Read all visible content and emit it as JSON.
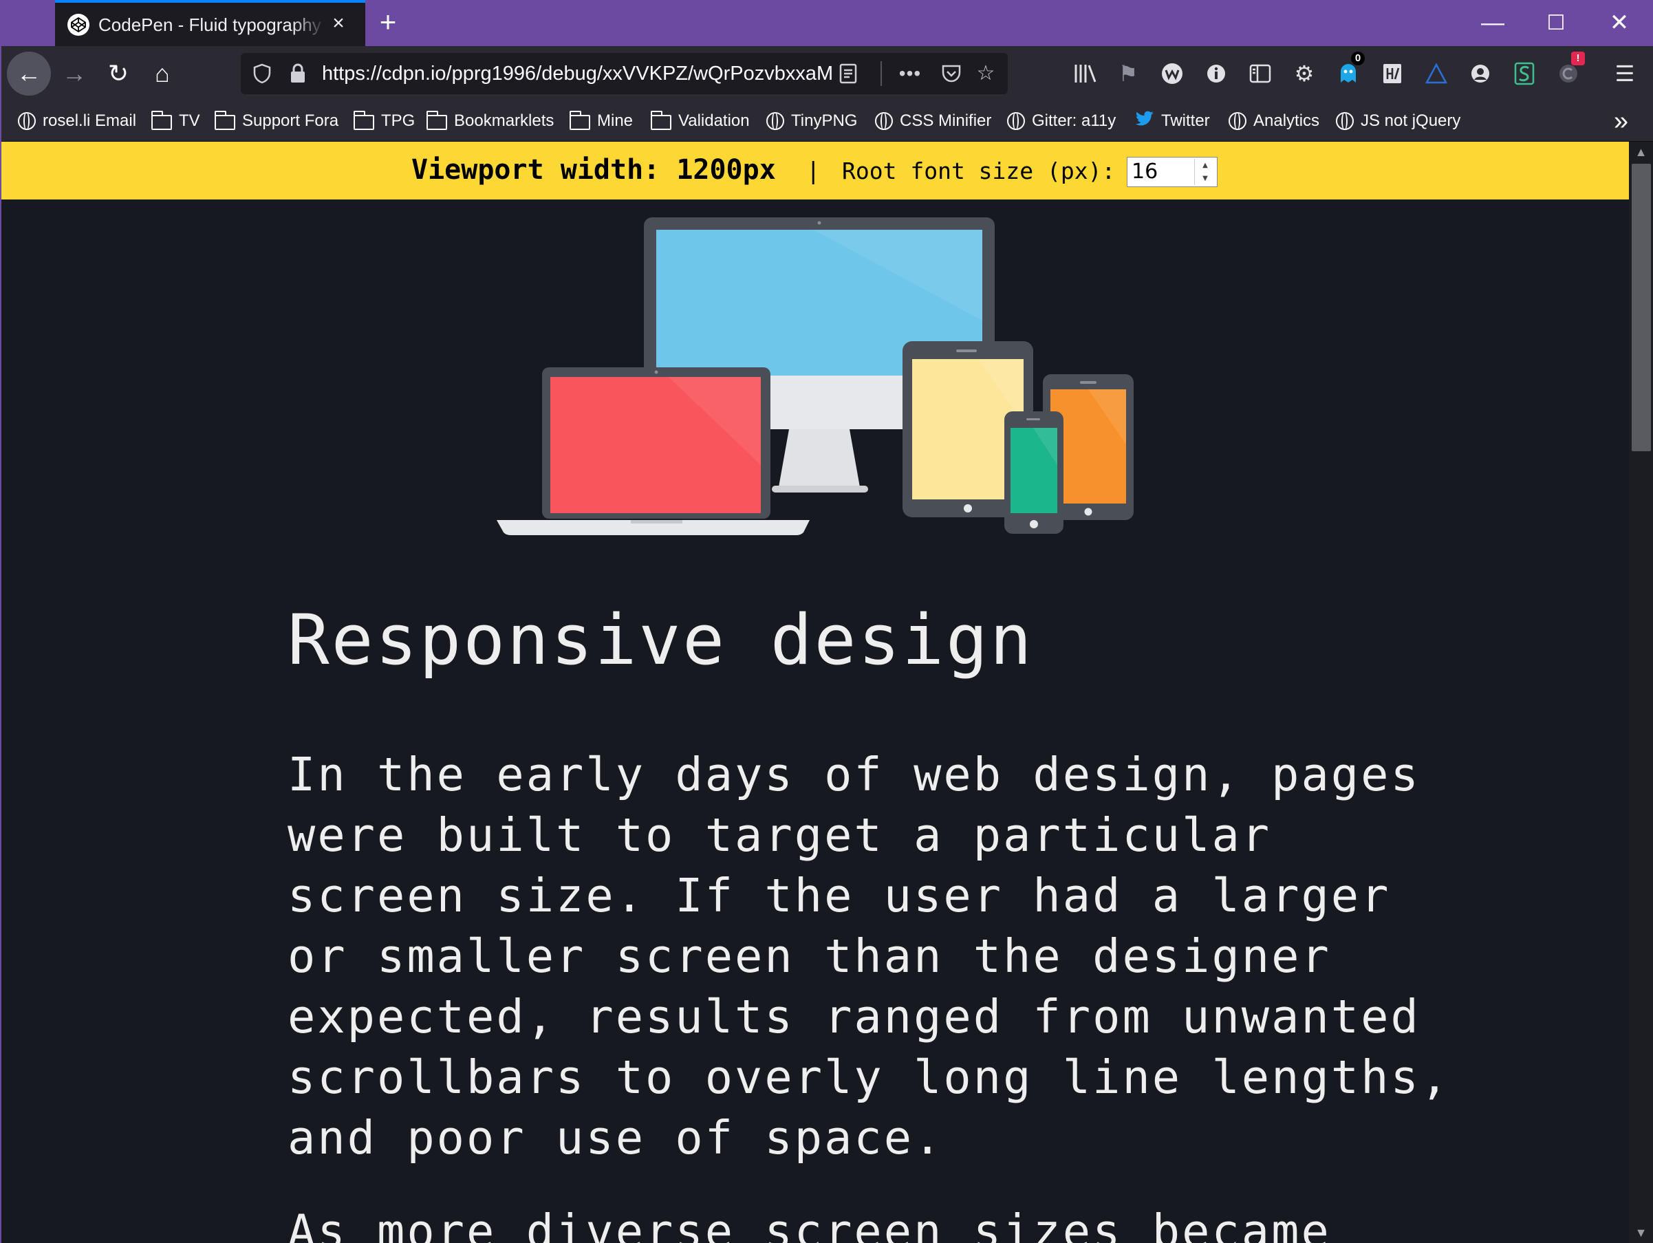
{
  "browser": {
    "tab": {
      "title": "CodePen - Fluid typography example",
      "close_icon": "×"
    },
    "new_tab_icon": "+",
    "window_controls": {
      "minimize": "—",
      "maximize": "☐",
      "close": "✕"
    },
    "nav": {
      "back_icon": "←",
      "forward_icon": "→",
      "reload_icon": "↻",
      "home_icon": "⌂",
      "url": "https://cdpn.io/pprg1996/debug/xxVVKPZ/wQrPozvbxxaM"
    },
    "toolbar_badges": {
      "ghostery_count": "0",
      "alert": "!"
    },
    "bookmarks": [
      {
        "label": "rosel.li Email",
        "icon": "globe-icon"
      },
      {
        "label": "TV",
        "icon": "folder-icon"
      },
      {
        "label": "Support Fora",
        "icon": "folder-icon"
      },
      {
        "label": "TPG",
        "icon": "folder-icon"
      },
      {
        "label": "Bookmarklets",
        "icon": "folder-icon"
      },
      {
        "label": "Mine",
        "icon": "folder-icon"
      },
      {
        "label": "Validation",
        "icon": "folder-icon"
      },
      {
        "label": "TinyPNG",
        "icon": "globe-icon"
      },
      {
        "label": "CSS Minifier",
        "icon": "globe-icon"
      },
      {
        "label": "Gitter: a11y",
        "icon": "globe-icon"
      },
      {
        "label": "Twitter",
        "icon": "twitter-bird-icon"
      },
      {
        "label": "Analytics",
        "icon": "globe-icon"
      },
      {
        "label": "JS not jQuery",
        "icon": "globe-icon"
      }
    ],
    "overflow_icon": "»"
  },
  "page": {
    "debug_bar": {
      "viewport_label": "Viewport width: 1200px",
      "separator": "|",
      "root_font_label": "Root font size (px):",
      "root_font_value": "16"
    },
    "heading": "Responsive design",
    "paragraph_1": "In the early days of web design, pages were built to target a particular screen size. If the user had a larger or smaller screen than the designer expected, results ranged from unwanted scrollbars to overly long line lengths, and poor use of space.",
    "paragraph_2": "As more diverse screen sizes became"
  },
  "colors": {
    "titlebar": "#6d4aa1",
    "toolbar": "#2b2a33",
    "debug_bar": "#fdd835",
    "page_bg": "#16191f",
    "text": "#eeeeee",
    "monitor_screen": "#6ec6ea",
    "laptop_screen": "#f9555d",
    "tablet_screen": "#fde59a",
    "phone_screen": "#1bb68b",
    "small_tablet_screen": "#f7912b"
  }
}
